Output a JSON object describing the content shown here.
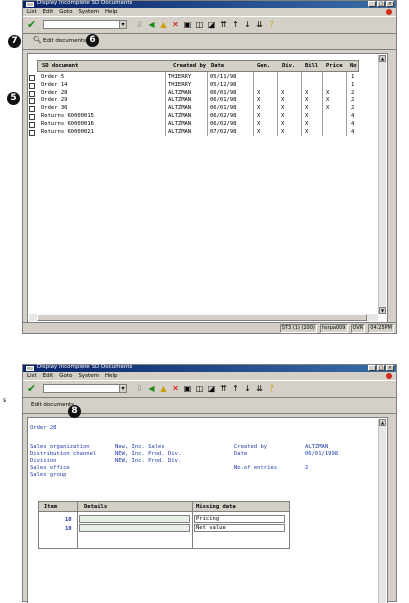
{
  "window1": {
    "title": "Display Incomplete SD Documents",
    "menu": [
      "List",
      "Edit",
      "Goto",
      "System",
      "Help"
    ],
    "app_toolbar": {
      "details_icon": "magnifier-icon",
      "edit_documents_label": "Edit documents"
    },
    "columns": [
      "SD document",
      "Created by",
      "Date",
      "Gen.",
      "Div.",
      "Bill",
      "Price",
      "No"
    ],
    "rows": [
      {
        "doc": "Order 5",
        "created_by": "THIERRY",
        "date": "05/11/98",
        "gen": "",
        "div": "",
        "bill": "",
        "price": "",
        "no": "1"
      },
      {
        "doc": "Order 14",
        "created_by": "THIERRY",
        "date": "05/12/98",
        "gen": "",
        "div": "",
        "bill": "",
        "price": "",
        "no": "1"
      },
      {
        "doc": "Order 28",
        "created_by": "ALTZMAN",
        "date": "06/01/98",
        "gen": "X",
        "div": "X",
        "bill": "X",
        "price": "X",
        "no": "2"
      },
      {
        "doc": "Order 29",
        "created_by": "ALTZMAN",
        "date": "06/01/98",
        "gen": "X",
        "div": "X",
        "bill": "X",
        "price": "X",
        "no": "2"
      },
      {
        "doc": "Order 30",
        "created_by": "ALTZMAN",
        "date": "06/01/98",
        "gen": "X",
        "div": "X",
        "bill": "X",
        "price": "X",
        "no": "2"
      },
      {
        "doc": "Returns 60000015",
        "created_by": "ALTZMAN",
        "date": "06/02/98",
        "gen": "X",
        "div": "X",
        "bill": "X",
        "price": "",
        "no": "4"
      },
      {
        "doc": "Returns 60000016",
        "created_by": "ALTZMAN",
        "date": "06/02/98",
        "gen": "X",
        "div": "X",
        "bill": "X",
        "price": "",
        "no": "4"
      },
      {
        "doc": "Returns 60000021",
        "created_by": "ALTZMAN",
        "date": "07/02/98",
        "gen": "X",
        "div": "X",
        "bill": "X",
        "price": "",
        "no": "4"
      }
    ],
    "status": {
      "system": "ST3 (1) (200)",
      "server": "hsrpa009",
      "mode": "OVR",
      "time": "04:25PM"
    }
  },
  "window2": {
    "title": "Display Incomplete SD Documents",
    "menu": [
      "List",
      "Edit",
      "Goto",
      "System",
      "Help"
    ],
    "app_toolbar": {
      "edit_documents_label": "Edit documents"
    },
    "doc_title": "Order 28",
    "left_labels": [
      "Sales organization",
      "Distribution channel",
      "Division",
      "Sales office",
      "Sales group"
    ],
    "left_values": [
      "New, Inc. Sales",
      "NEW, Inc. Prod. Div.",
      "NEW, Inc. Prod. Div."
    ],
    "right_labels": [
      "Created by",
      "Date",
      "No.of entries"
    ],
    "right_values": [
      "ALTZMAN",
      "06/01/1998",
      "2"
    ],
    "grid_headers": [
      "Item",
      "Details",
      "Missing data"
    ],
    "grid_rows": [
      {
        "item": "10",
        "missing": "Pricing"
      },
      {
        "item": "10",
        "missing": "Net value"
      }
    ]
  },
  "callouts": {
    "b7": "7",
    "b6": "6",
    "b5": "5",
    "b8": "8"
  },
  "side_letter": "s",
  "icons": [
    "checkmark-icon",
    "back-icon",
    "exit-icon",
    "cancel-icon",
    "print-icon",
    "find-icon",
    "find-next-icon",
    "first-page-icon",
    "prev-page-icon",
    "next-page-icon",
    "last-page-icon",
    "help-icon"
  ]
}
